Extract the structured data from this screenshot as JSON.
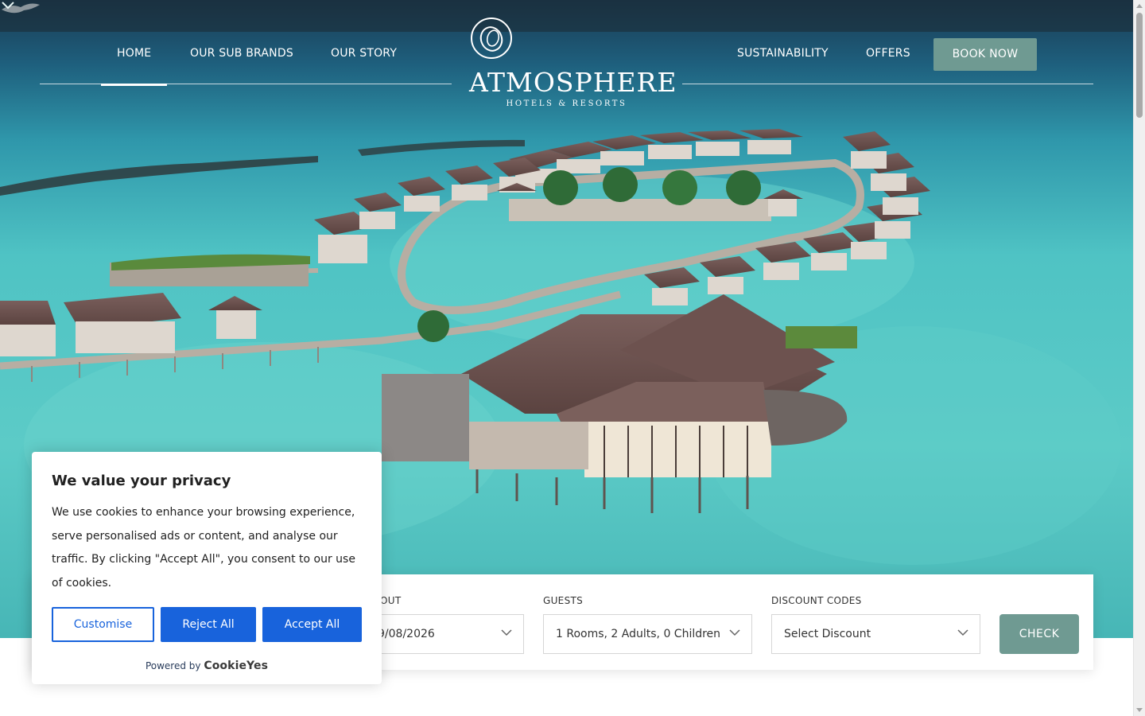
{
  "nav": {
    "left": [
      "HOME",
      "OUR SUB BRANDS",
      "OUR STORY"
    ],
    "right": [
      "SUSTAINABILITY",
      "OFFERS"
    ],
    "book_now": "BOOK NOW",
    "active": "HOME"
  },
  "logo": {
    "name": "ATMOSPHERE",
    "tagline": "HOTELS & RESORTS"
  },
  "booking": {
    "checkout_label": "OUT",
    "checkout_value": "9/08/2026",
    "guests_label": "GUESTS",
    "guests_value": "1 Rooms, 2 Adults, 0 Children",
    "discount_label": "DISCOUNT CODES",
    "discount_value": "Select Discount",
    "check": "CHECK"
  },
  "cookie": {
    "title": "We value your privacy",
    "text": "We use cookies to enhance your browsing experience, serve personalised ads or content, and analyse our traffic. By clicking \"Accept All\", you consent to our use of cookies.",
    "customise": "Customise",
    "reject": "Reject All",
    "accept": "Accept All",
    "powered_by": "Powered by",
    "brand": "CookieYes"
  },
  "colors": {
    "accent": "#6f9a92",
    "cookie_blue": "#1863dc"
  },
  "icons": [
    "logo-mark-icon",
    "chevron-down-icon",
    "corner-logo-icon"
  ]
}
